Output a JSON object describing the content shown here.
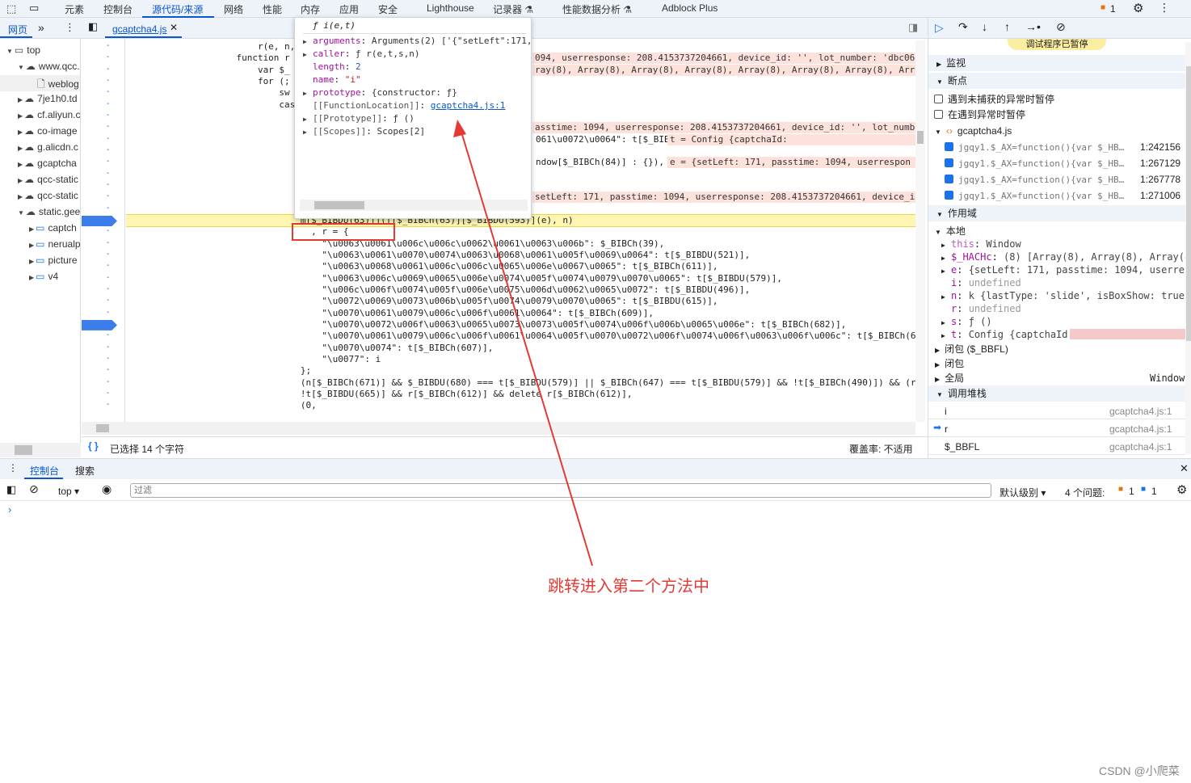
{
  "top_tabs": [
    "元素",
    "控制台",
    "源代码/来源",
    "网络",
    "性能",
    "内存",
    "应用",
    "安全",
    "Lighthouse",
    "记录器 ⚗",
    "性能数据分析 ⚗",
    "Adblock Plus"
  ],
  "top_active": "源代码/来源",
  "issues_badge": "1",
  "nav": {
    "tab": "网页",
    "more": "»",
    "tree": [
      {
        "label": "top",
        "icon": "frame-icon",
        "d": 0,
        "open": true
      },
      {
        "label": "www.qcc.",
        "icon": "cloud-icon",
        "d": 1,
        "open": true
      },
      {
        "label": "weblog",
        "icon": "file-icon",
        "d": 2,
        "selected": true
      },
      {
        "label": "7je1h0.td",
        "icon": "cloud-icon",
        "d": 1
      },
      {
        "label": "cf.aliyun.c",
        "icon": "cloud-icon",
        "d": 1
      },
      {
        "label": "co-image",
        "icon": "cloud-icon",
        "d": 1
      },
      {
        "label": "g.alicdn.c",
        "icon": "cloud-icon",
        "d": 1
      },
      {
        "label": "gcaptcha",
        "icon": "cloud-icon",
        "d": 1
      },
      {
        "label": "qcc-static",
        "icon": "cloud-icon",
        "d": 1
      },
      {
        "label": "qcc-static",
        "icon": "cloud-icon",
        "d": 1
      },
      {
        "label": "static.gee",
        "icon": "cloud-icon",
        "d": 1,
        "open": true
      },
      {
        "label": "captch",
        "icon": "folder-icon",
        "d": 2
      },
      {
        "label": "nerualp",
        "icon": "folder-icon",
        "d": 2
      },
      {
        "label": "picture",
        "icon": "folder-icon",
        "d": 2
      },
      {
        "label": "v4",
        "icon": "folder-icon",
        "d": 2
      }
    ]
  },
  "editor": {
    "file_tab": "gcaptcha4.js",
    "code": [
      {
        "l": "                        r(e, n,"
      },
      {
        "l": "                    function r",
        "r": "094, userresponse: 208.4153737204661, device_id: '', lot_number: 'dbc06"
      },
      {
        "l": "                        var $_",
        "r": "ray(8), Array(8), Array(8), Array(8), Array(8), Array(8), Array(8), Arr"
      },
      {
        "l": "                        for (;"
      },
      {
        "l": "                            sw"
      },
      {
        "l": "                            cas"
      },
      {
        "l": ""
      },
      {
        "l": "",
        "r": "asstime: 1094, userresponse: 208.4153737204661, device_id: '', lot_numbe"
      },
      {
        "l": "",
        "r2": "061\\u0072\\u0064\": t[$_BIBCh(591)]",
        "r": "t = Config {captchaId: "
      },
      {
        "l": ""
      },
      {
        "l": "",
        "r2": "ndow[$_BIBCh(84)] : {}),",
        "r": "e = {setLeft: 171, passtime: 1094, userrespon"
      },
      {
        "l": ""
      },
      {
        "l": ""
      },
      {
        "l": "",
        "r": "setLeft: 171, passtime: 1094, userresponse: 208.4153737204661, device_i"
      },
      {
        "l": "                                var i = (0,",
        "r3": "i = undefined"
      },
      {
        "l": "                                m[$_BIBDU(63)]](f[$_BIBCh(63)][$_BIBDU(593)](e), n)",
        "hl": true
      },
      {
        "l": "                                  , r = {"
      },
      {
        "l": "                                    \"\\u0063\\u0061\\u006c\\u006c\\u0062\\u0061\\u0063\\u006b\": $_BIBCh(39),"
      },
      {
        "l": "                                    \"\\u0063\\u0061\\u0070\\u0074\\u0063\\u0068\\u0061\\u005f\\u0069\\u0064\": t[$_BIBDU(521)],"
      },
      {
        "l": "                                    \"\\u0063\\u0068\\u0061\\u006c\\u006c\\u0065\\u006e\\u0067\\u0065\": t[$_BIBCh(611)],"
      },
      {
        "l": "                                    \"\\u0063\\u006c\\u0069\\u0065\\u006e\\u0074\\u005f\\u0074\\u0079\\u0070\\u0065\": t[$_BIBDU(579)],"
      },
      {
        "l": "                                    \"\\u006c\\u006f\\u0074\\u005f\\u006e\\u0075\\u006d\\u0062\\u0065\\u0072\": t[$_BIBDU(496)],"
      },
      {
        "l": "                                    \"\\u0072\\u0069\\u0073\\u006b\\u005f\\u0074\\u0079\\u0070\\u0065\": t[$_BIBDU(615)],"
      },
      {
        "l": "                                    \"\\u0070\\u0061\\u0079\\u006c\\u006f\\u0061\\u0064\": t[$_BIBCh(609)],"
      },
      {
        "l": "                                    \"\\u0070\\u0072\\u006f\\u0063\\u0065\\u0073\\u0073\\u005f\\u0074\\u006f\\u006b\\u0065\\u006e\": t[$_BIBCh(682)],"
      },
      {
        "l": "                                    \"\\u0070\\u0061\\u0079\\u006c\\u006f\\u0061\\u0064\\u005f\\u0070\\u0072\\u006f\\u0074\\u006f\\u0063\\u006f\\u006c\": t[$_BIBCh(6"
      },
      {
        "l": "                                    \"\\u0070\\u0074\": t[$_BIBCh(607)],"
      },
      {
        "l": "                                    \"\\u0077\": i"
      },
      {
        "l": "                                };"
      },
      {
        "l": "                                (n[$_BIBCh(671)] && $_BIBDU(680) === t[$_BIBDU(579)] || $_BIBCh(647) === t[$_BIBDU(579)] && !t[$_BIBCh(490)]) && (r"
      },
      {
        "l": "                                !t[$_BIBDU(665)] && r[$_BIBCh(612)] && delete r[$_BIBCh(612)],"
      },
      {
        "l": "                                (0,"
      }
    ],
    "breakpoint_lines": [
      16,
      25
    ]
  },
  "popup": {
    "title": "ƒ i(e,t)",
    "rows": [
      {
        "k": "arguments",
        "v": "Arguments(2) ['{\"setLeft\":171,",
        "x": true
      },
      {
        "k": "caller",
        "v": "ƒ r(e,t,s,n)",
        "x": true
      },
      {
        "k": "length",
        "v": "2"
      },
      {
        "k": "name",
        "v": "\"i\""
      },
      {
        "k": "prototype",
        "v": "{constructor: ƒ}",
        "x": true
      },
      {
        "k": "[[FunctionLocation]]",
        "v": "gcaptcha4.js:1",
        "link": true
      },
      {
        "k": "[[Prototype]]",
        "v": "ƒ ()",
        "x": true
      },
      {
        "k": "[[Scopes]]",
        "v": "Scopes[2]",
        "x": true
      }
    ]
  },
  "status": {
    "selection": "已选择 14 个字符",
    "coverage": "覆盖率: 不适用"
  },
  "right": {
    "paused_banner": "调试程序已暂停",
    "watch": "监视",
    "breakpoints": "断点",
    "pause_uncaught": "遇到未捕获的异常时暂停",
    "pause_caught": "在遇到异常时暂停",
    "bp_file": "gcaptcha4.js",
    "bp_items": [
      {
        "code": "jgqy1.$_AX=function(){var $_HB…",
        "loc": "1:242156"
      },
      {
        "code": "jgqy1.$_AX=function(){var $_HB…",
        "loc": "1:267129"
      },
      {
        "code": "jgqy1.$_AX=function(){var $_HB…",
        "loc": "1:267778"
      },
      {
        "code": "jgqy1.$_AX=function(){var $_HB…",
        "loc": "1:271006"
      }
    ],
    "scope": "作用域",
    "local": "本地",
    "locals": [
      {
        "k": "this",
        "v": "Window",
        "x": true,
        "dim": true
      },
      {
        "k": "$_HACHc",
        "v": "(8) [Array(8), Array(8), Array(8),",
        "x": true
      },
      {
        "k": "e",
        "v": "{setLeft: 171, passtime: 1094, userrespon",
        "x": true
      },
      {
        "k": "i",
        "v": "undefined",
        "u": true
      },
      {
        "k": "n",
        "v": "k {lastType: 'slide', isBoxShow: true, op",
        "x": true
      },
      {
        "k": "r",
        "v": "undefined",
        "u": true
      },
      {
        "k": "s",
        "v": "ƒ ()",
        "x": true
      },
      {
        "k": "t",
        "v": "Config {captchaId:",
        "x": true
      }
    ],
    "closure1": "闭包 ($_BBFL)",
    "closure2": "闭包",
    "global": "全局",
    "global_val": "Window",
    "callstack": "调用堆栈",
    "frames": [
      {
        "name": "i",
        "loc": "gcaptcha4.js:1"
      },
      {
        "name": "r",
        "loc": "gcaptcha4.js:1",
        "current": true
      },
      {
        "name": "$_BBFL",
        "loc": "gcaptcha4.js:1"
      }
    ]
  },
  "drawer": {
    "tabs": [
      "控制台",
      "搜索"
    ],
    "context": "top",
    "filter_placeholder": "过滤",
    "level": "默认级别",
    "issues": "4 个问题:",
    "issue_warn": "1",
    "issue_info": "1",
    "prompt": "›"
  },
  "annotation": {
    "text": "跳转进入第二个方法中",
    "color": "#e53935"
  },
  "watermark": "CSDN @小爬菜"
}
